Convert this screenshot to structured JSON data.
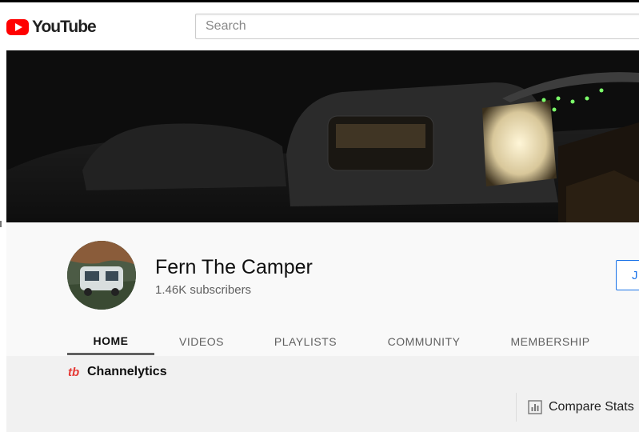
{
  "masthead": {
    "logo_text": "YouTube",
    "search_placeholder": "Search"
  },
  "channel": {
    "name": "Fern The Camper",
    "subscribers": "1.46K subscribers",
    "join_label": "J"
  },
  "tabs": [
    {
      "label": "HOME",
      "active": true
    },
    {
      "label": "VIDEOS",
      "active": false
    },
    {
      "label": "PLAYLISTS",
      "active": false
    },
    {
      "label": "COMMUNITY",
      "active": false
    },
    {
      "label": "MEMBERSHIP",
      "active": false
    }
  ],
  "extension": {
    "logo_text": "tb",
    "name": "Channelytics",
    "compare_label": "Compare Stats"
  },
  "colors": {
    "brand_red": "#ff0000",
    "join_blue": "#1a73e8",
    "channelytics_red": "#e53935"
  },
  "icons": [
    "youtube-logo-icon",
    "compare-stats-icon"
  ]
}
